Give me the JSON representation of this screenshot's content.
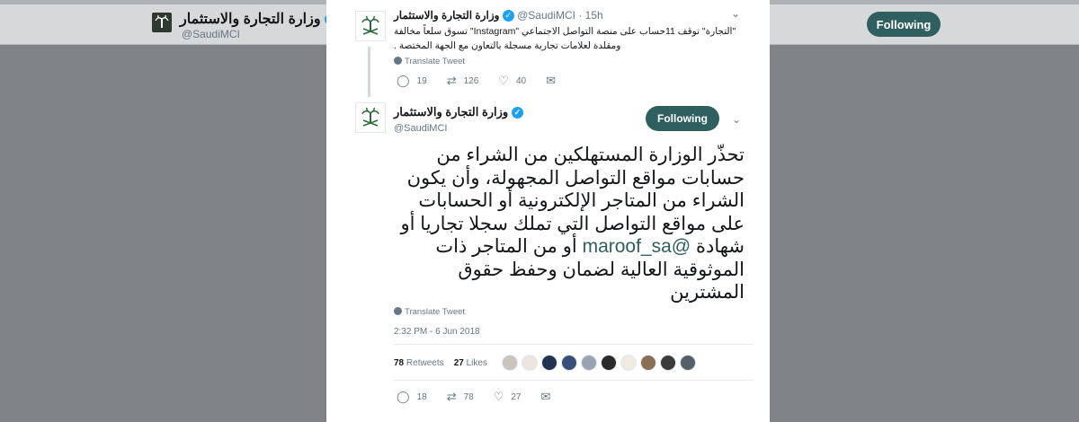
{
  "background": {
    "account_name": "وزارة التجارة والاستثمار",
    "account_handle": "@SaudiMCI",
    "follow_label": "Following"
  },
  "parent_tweet": {
    "name": "وزارة التجارة والاستثمار",
    "handle_time": "@SaudiMCI · 15h",
    "text": "\"التجارة\" توقف 11حساب على منصة التواصل الاجتماعي \"Instagram\" تسوق سلعاً مخالفة ومقلدة لعلامات تجارية مسجلة بالتعاون مع الجهة المختصة .",
    "translate_label": "Translate Tweet",
    "replies": "19",
    "retweets": "126",
    "likes": "40"
  },
  "main_tweet": {
    "name": "وزارة التجارة والاستثمار",
    "handle": "@SaudiMCI",
    "follow_label": "Following",
    "text_before": "تحذّر الوزارة المستهلكين من الشراء من حسابات مواقع التواصل المجهولة، وأن يكون الشراء من المتاجر الإلكترونية أو الحسابات على مواقع التواصل التي تملك سجلا تجاريا أو  شهادة ",
    "mention": "@maroof_sa",
    "text_after": " أو من المتاجر ذات الموثوقية العالية لضمان وحفظ حقوق المشترين",
    "translate_label": "Translate Tweet",
    "timestamp": "2:32 PM - 6 Jun 2018",
    "retweets_count": "78",
    "retweets_label": "Retweets",
    "likes_count": "27",
    "likes_label": "Likes",
    "replies": "18",
    "retweets": "78",
    "likes": "27"
  },
  "icons": {
    "reply": "reply-icon",
    "retweet": "retweet-icon",
    "like": "heart-icon",
    "message": "direct-message-icon",
    "verified": "verified-badge-icon",
    "globe": "globe-icon",
    "chevron": "chevron-down-icon"
  },
  "colors": {
    "accent": "#2f5f5f",
    "verified": "#1da1f2",
    "muted": "#657786",
    "overlay": "#7f8286"
  },
  "liker_colors": [
    "#c9c4bc",
    "#efe5e0",
    "#23324f",
    "#3a4e7a",
    "#9aa3b0",
    "#2b2b2b",
    "#f0ebe2",
    "#8a6f55",
    "#3b3b3b",
    "#556068"
  ]
}
